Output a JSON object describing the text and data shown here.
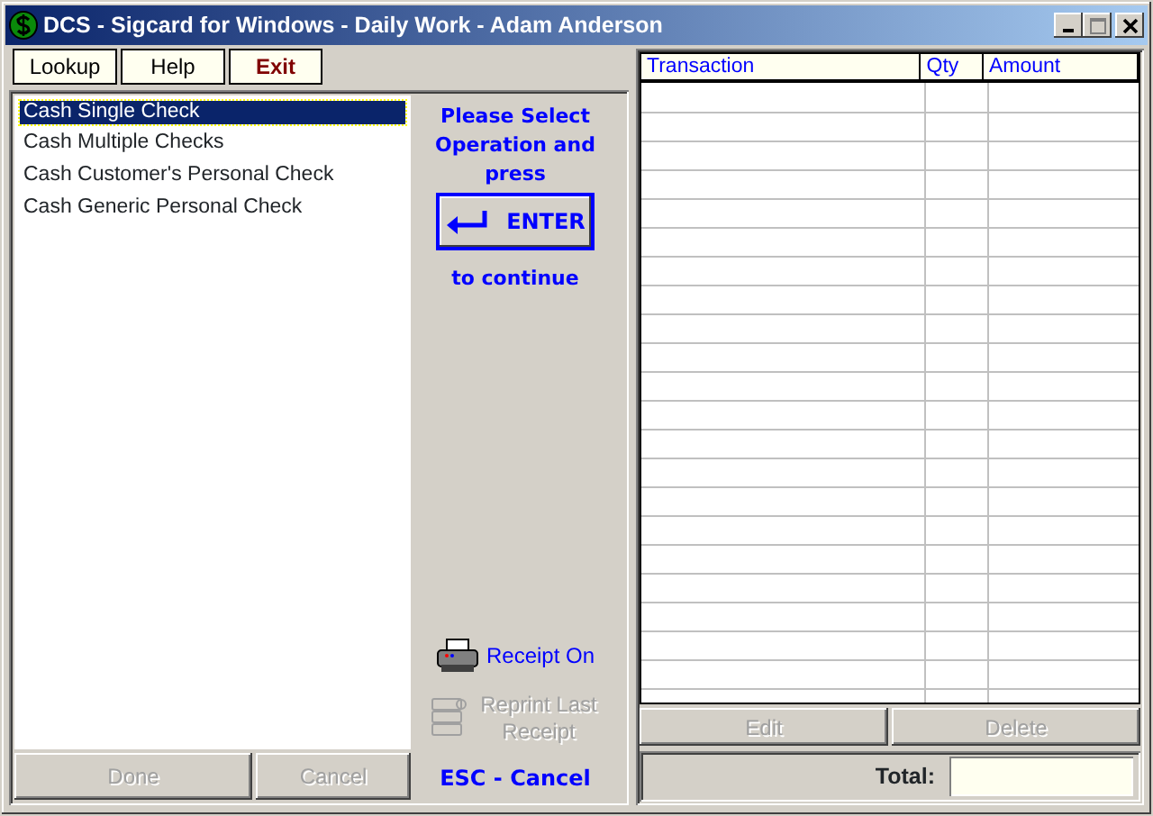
{
  "window": {
    "title": "DCS - Sigcard for Windows - Daily Work - Adam Anderson"
  },
  "menu": [
    {
      "label": "Lookup",
      "kind": "normal"
    },
    {
      "label": "Help",
      "kind": "normal"
    },
    {
      "label": "Exit",
      "kind": "exit"
    }
  ],
  "operations": [
    {
      "label": "Cash Single Check",
      "selected": true
    },
    {
      "label": "Cash Multiple Checks",
      "selected": false
    },
    {
      "label": "Cash Customer's Personal Check",
      "selected": false
    },
    {
      "label": "Cash Generic Personal Check",
      "selected": false
    }
  ],
  "list_buttons": [
    {
      "label": "Done",
      "disabled": true
    },
    {
      "label": "Cancel",
      "disabled": true
    }
  ],
  "prompt": {
    "text": "Please Select Operation and press",
    "enter_label": "ENTER",
    "after": "to continue"
  },
  "receipt_actions": [
    {
      "label": "Receipt On",
      "kind": "printer",
      "disabled": false
    },
    {
      "label": "Reprint Last Receipt",
      "kind": "reprint",
      "disabled": true
    }
  ],
  "escape_hint": "ESC - Cancel",
  "table": {
    "columns": [
      "Transaction",
      "Qty",
      "Amount"
    ]
  },
  "table_buttons": [
    {
      "label": "Edit",
      "disabled": true
    },
    {
      "label": "Delete",
      "disabled": true
    }
  ],
  "total": {
    "label": "Total:"
  }
}
